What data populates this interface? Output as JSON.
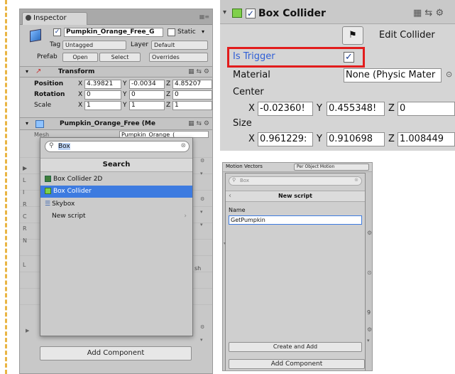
{
  "inspector": {
    "tab": "Inspector",
    "object_name": "Pumpkin_Orange_Free_G",
    "static_label": "Static",
    "tag_label": "Tag",
    "tag_value": "Untagged",
    "layer_label": "Layer",
    "layer_value": "Default",
    "prefab_label": "Prefab",
    "open_label": "Open",
    "select_label": "Select",
    "overrides_label": "Overrides",
    "transform_title": "Transform",
    "position_label": "Position",
    "position": {
      "x": "4.39821",
      "y": "-0.0034",
      "z": "4.85207"
    },
    "rotation_label": "Rotation",
    "rotation": {
      "x": "0",
      "y": "0",
      "z": "0"
    },
    "scale_label": "Scale",
    "scale": {
      "x": "1",
      "y": "1",
      "z": "1"
    },
    "mesh_title": "Pumpkin_Orange_Free (Me",
    "mesh_label": "Mesh",
    "mesh_value": "Pumpkin_Orange_(",
    "search_value": "Box",
    "search_title": "Search",
    "results": [
      "Box Collider 2D",
      "Box Collider",
      "Skybox",
      "New script"
    ],
    "side_text": "sh",
    "add_component": "Add Component"
  },
  "box_collider": {
    "title": "Box Collider",
    "edit_collider": "Edit Collider",
    "is_trigger": "Is Trigger",
    "material_label": "Material",
    "material_value": "None (Physic Mater",
    "center_label": "Center",
    "center": {
      "x": "-0.02360!",
      "y": "0.455348!",
      "z": "0"
    },
    "size_label": "Size",
    "size": {
      "x": "0.961229:",
      "y": "0.910698",
      "z": "1.008449"
    },
    "axis": {
      "x": "X",
      "y": "Y",
      "z": "Z"
    }
  },
  "new_script": {
    "motion_vectors": "Motion Vectors",
    "per_object": "Per Object Motion",
    "search_value": "Box",
    "title": "New script",
    "name_label": "Name",
    "name_value": "GetPumpkin",
    "side_num": "9",
    "create_and_add": "Create and Add",
    "add_component": "Add Component"
  },
  "colors": {
    "selected": "#3d7be0",
    "trigger_highlight": "#e21c1c",
    "link_blue": "#2f5fd6"
  }
}
